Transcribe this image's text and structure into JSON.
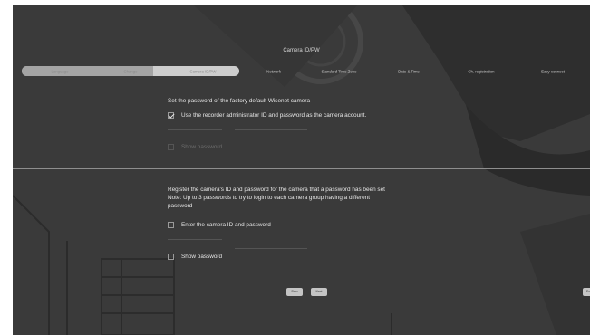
{
  "title": "Camera ID/PW",
  "steps": [
    {
      "label": "Language",
      "state": "done"
    },
    {
      "label": "Change",
      "state": "done"
    },
    {
      "label": "Camera ID/PW",
      "state": "current"
    },
    {
      "label": "Network",
      "state": "pending"
    },
    {
      "label": "Standard Time Zone",
      "state": "pending"
    },
    {
      "label": "Date & Time",
      "state": "pending"
    },
    {
      "label": "Ch. registration",
      "state": "pending"
    },
    {
      "label": "Easy connect",
      "state": "pending"
    }
  ],
  "section1": {
    "heading": "Set the password of the factory default Wisenet camera",
    "use_recorder_label": "Use the recorder administrator ID and password as the camera account.",
    "use_recorder_checked": true,
    "show_password_label": "Show password",
    "show_password_checked": false
  },
  "section2": {
    "line1": "Register the camera's ID and password for the camera that a password has been set",
    "line2": "Note: Up to 3 passwords to try to login to each camera group having a different",
    "line3": "password",
    "enter_label": "Enter the camera ID and password",
    "enter_checked": false,
    "show_password_label": "Show password",
    "show_password_checked": false
  },
  "buttons": {
    "prev": "Prev",
    "next": "Next",
    "edge": "Ex"
  },
  "colors": {
    "background": "#3a3a3a",
    "track": "#b9b9b9",
    "step_done": "#a4a4a4",
    "step_current": "#cdcdcd",
    "text": "#e6e6e6",
    "divider": "#8e8e8e",
    "button": "#c4c4c4"
  }
}
